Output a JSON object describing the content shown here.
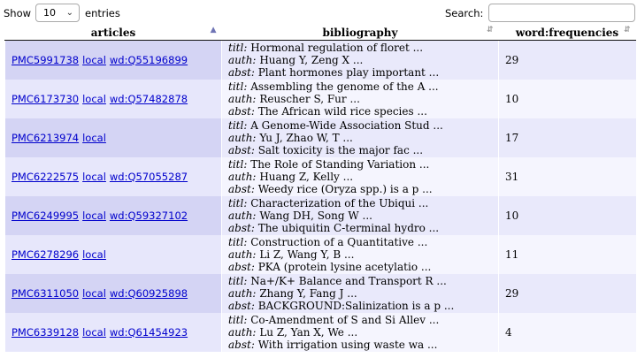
{
  "controls": {
    "show_label": "Show",
    "entries_value": "10",
    "entries_label": "entries",
    "search_label": "Search:"
  },
  "columns": [
    "articles",
    "bibliography",
    "word:frequencies"
  ],
  "bib_labels": {
    "titl": "titl:",
    "auth": "auth:",
    "abst": "abst:"
  },
  "rows": [
    {
      "pmc": "PMC5991738",
      "local": "local",
      "wd": "wd:Q55196899",
      "titl": "Hormonal regulation of floret ...",
      "auth": "Huang Y, Zeng X ...",
      "abst": "Plant hormones play important ...",
      "freq": "29"
    },
    {
      "pmc": "PMC6173730",
      "local": "local",
      "wd": "wd:Q57482878",
      "titl": "Assembling the genome of the A ...",
      "auth": "Reuscher S, Fur ...",
      "abst": "The African wild rice species ...",
      "freq": "10"
    },
    {
      "pmc": "PMC6213974",
      "local": "local",
      "wd": "",
      "titl": "A Genome-Wide Association Stud ...",
      "auth": "Yu J, Zhao W, T ...",
      "abst": "Salt toxicity is the major fac ...",
      "freq": "17"
    },
    {
      "pmc": "PMC6222575",
      "local": "local",
      "wd": "wd:Q57055287",
      "titl": "The Role of Standing Variation ...",
      "auth": "Huang Z, Kelly ...",
      "abst": "Weedy rice (Oryza spp.) is a p ...",
      "freq": "31"
    },
    {
      "pmc": "PMC6249995",
      "local": "local",
      "wd": "wd:Q59327102",
      "titl": "Characterization of the Ubiqui ...",
      "auth": "Wang DH, Song W ...",
      "abst": "The ubiquitin C-terminal hydro ...",
      "freq": "10"
    },
    {
      "pmc": "PMC6278296",
      "local": "local",
      "wd": "",
      "titl": "Construction of a Quantitative ...",
      "auth": "Li Z, Wang Y, B ...",
      "abst": "PKA (protein lysine acetylatio ...",
      "freq": "11"
    },
    {
      "pmc": "PMC6311050",
      "local": "local",
      "wd": "wd:Q60925898",
      "titl": "Na+/K+ Balance and Transport R ...",
      "auth": "Zhang Y, Fang J ...",
      "abst": "BACKGROUND:Salinization is a p ...",
      "freq": "29"
    },
    {
      "pmc": "PMC6339128",
      "local": "local",
      "wd": "wd:Q61454923",
      "titl": "Co-Amendment of S and Si Allev ...",
      "auth": "Lu Z, Yan X, We ...",
      "abst": "With irrigation using waste wa ...",
      "freq": "4"
    }
  ]
}
